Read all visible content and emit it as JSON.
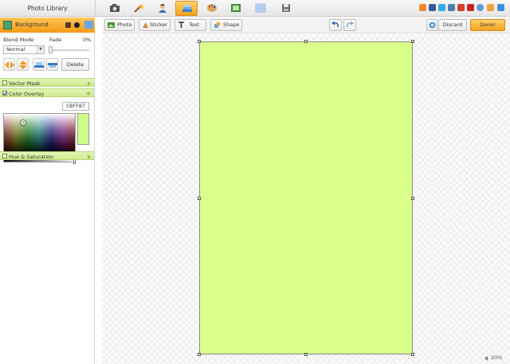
{
  "window": {
    "library_title": "Photo Library"
  },
  "main_tabs": [
    {
      "icon": "camera-icon"
    },
    {
      "icon": "magic-wand-icon"
    },
    {
      "icon": "person-icon"
    },
    {
      "icon": "layers-icon",
      "active": true
    },
    {
      "icon": "palette-icon"
    },
    {
      "icon": "picture-frame-icon"
    },
    {
      "icon": "grid-icon"
    },
    {
      "icon": "save-icon"
    }
  ],
  "social": [
    {
      "icon": "home-icon",
      "color": "#f08a2a"
    },
    {
      "icon": "facebook-icon",
      "color": "#3b5998"
    },
    {
      "icon": "twitter-icon",
      "color": "#39a9e0"
    },
    {
      "icon": "myspace-icon",
      "color": "#4b7db8"
    },
    {
      "icon": "google-plus-icon",
      "color": "#d0402e"
    },
    {
      "icon": "pinterest-icon",
      "color": "#c8232c"
    },
    {
      "icon": "help-icon",
      "color": "#5c9ad6"
    },
    {
      "icon": "email-icon",
      "color": "#f0a23a"
    },
    {
      "icon": "fullscreen-icon",
      "color": "#3f8dd9"
    }
  ],
  "layer": {
    "name": "Background",
    "blend_mode_label": "Blend Mode",
    "blend_mode_value": "Normal",
    "fade_label": "Fade",
    "fade_value": "0%",
    "fade_level": 0,
    "delete_label": "Delete"
  },
  "sections": {
    "vector_mask": {
      "label": "Vector Mask",
      "checked": false
    },
    "color_overlay": {
      "label": "Color Overlay",
      "checked": true,
      "hex": "CBFF87"
    },
    "hue_saturation": {
      "label": "Hue & Saturation",
      "checked": false
    }
  },
  "colors": {
    "accent": "#f6a21f",
    "section_green": "#d6f09e",
    "overlay_color": "#cbff87",
    "artboard_fill": "#d9ff8a"
  },
  "toolbar": {
    "photo_label": "Photo",
    "sticker_label": "Sticker",
    "text_label": "Text",
    "shape_label": "Shape",
    "discard_label": "Discard",
    "done_label": "Done!"
  },
  "canvas": {
    "zoom": "20%"
  }
}
